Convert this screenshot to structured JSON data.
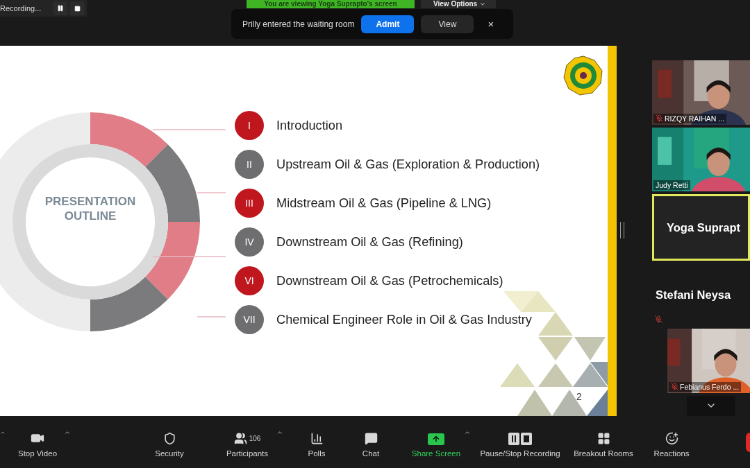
{
  "recording": {
    "label": "Recording..."
  },
  "banner": {
    "text": "You are viewing Yoga Suprapto's screen"
  },
  "view_options": {
    "label": "View Options"
  },
  "notification": {
    "message": "Prilly entered the waiting room",
    "admit": "Admit",
    "view": "View",
    "close": "×"
  },
  "slide": {
    "title": "PRESENTATION OUTLINE",
    "page": "2",
    "items": [
      {
        "numeral": "I",
        "label": "Introduction",
        "color": "#c0161d"
      },
      {
        "numeral": "II",
        "label": "Upstream Oil & Gas (Exploration & Production)",
        "color": "#6e6e70"
      },
      {
        "numeral": "III",
        "label": "Midstream Oil & Gas (Pipeline & LNG)",
        "color": "#c0161d"
      },
      {
        "numeral": "IV",
        "label": "Downstream Oil & Gas (Refining)",
        "color": "#6e6e70"
      },
      {
        "numeral": "VI",
        "label": "Downstream Oil & Gas (Petrochemicals)",
        "color": "#c0161d"
      },
      {
        "numeral": "VII",
        "label": "Chemical Engineer Role in Oil & Gas Industry",
        "color": "#6e6e70"
      }
    ]
  },
  "participants": [
    {
      "name": "RIZQY RAIHAN ...",
      "kind": "video",
      "muted": true,
      "active": false
    },
    {
      "name": "Judy Retti",
      "kind": "video",
      "muted": false,
      "active": false
    },
    {
      "name": "Yoga Suprapt",
      "kind": "name",
      "muted": false,
      "active": true
    },
    {
      "name": "Stefani  Neysa",
      "kind": "name",
      "muted": true,
      "active": false
    },
    {
      "name": "Febianus Ferdo ...",
      "kind": "video",
      "muted": true,
      "active": false
    }
  ],
  "toolbar": [
    {
      "label": "Stop Video",
      "kind": "video",
      "caret": true
    },
    {
      "label": "Security",
      "kind": "security",
      "caret": false
    },
    {
      "label": "Participants",
      "kind": "participants",
      "count": "106",
      "caret": true
    },
    {
      "label": "Polls",
      "kind": "polls",
      "caret": false
    },
    {
      "label": "Chat",
      "kind": "chat",
      "caret": false
    },
    {
      "label": "Share Screen",
      "kind": "share",
      "caret": true
    },
    {
      "label": "Pause/Stop Recording",
      "kind": "recording",
      "caret": false
    },
    {
      "label": "Breakout Rooms",
      "kind": "breakout",
      "caret": false
    },
    {
      "label": "Reactions",
      "kind": "reactions",
      "caret": false
    }
  ]
}
